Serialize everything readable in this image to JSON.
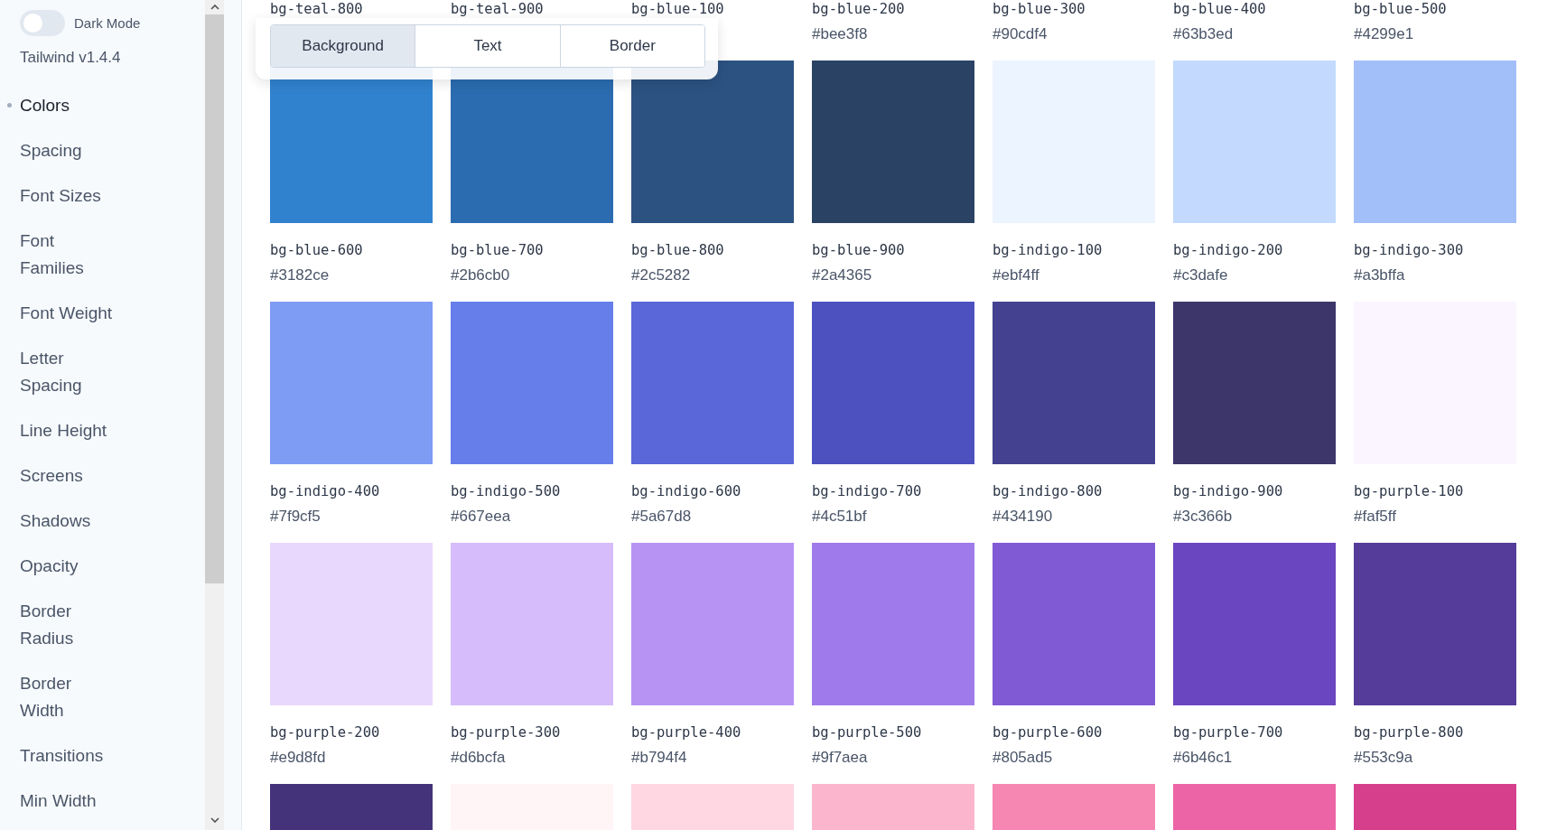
{
  "sidebar": {
    "dark_mode": {
      "label": "Dark Mode",
      "on": false
    },
    "version": "Tailwind v1.4.4",
    "nav": [
      {
        "label": "Colors",
        "selected": true
      },
      {
        "label": "Spacing",
        "selected": false
      },
      {
        "label": "Font Sizes",
        "selected": false
      },
      {
        "label": "Font Families",
        "selected": false
      },
      {
        "label": "Font Weight",
        "selected": false
      },
      {
        "label": "Letter Spacing",
        "selected": false
      },
      {
        "label": "Line Height",
        "selected": false
      },
      {
        "label": "Screens",
        "selected": false
      },
      {
        "label": "Shadows",
        "selected": false
      },
      {
        "label": "Opacity",
        "selected": false
      },
      {
        "label": "Border Radius",
        "selected": false
      },
      {
        "label": "Border Width",
        "selected": false
      },
      {
        "label": "Transitions",
        "selected": false
      },
      {
        "label": "Min Width",
        "selected": false
      }
    ]
  },
  "mode_tabs": [
    {
      "label": "Background",
      "selected": true
    },
    {
      "label": "Text",
      "selected": false
    },
    {
      "label": "Border",
      "selected": false
    }
  ],
  "swatch_rows": [
    [
      {
        "name": "bg-teal-800"
      },
      {
        "name": "bg-teal-900"
      },
      {
        "name": "bg-blue-100"
      },
      {
        "name": "bg-blue-200",
        "hex": "#bee3f8"
      },
      {
        "name": "bg-blue-300",
        "hex": "#90cdf4"
      },
      {
        "name": "bg-blue-400",
        "hex": "#63b3ed"
      },
      {
        "name": "bg-blue-500",
        "hex": "#4299e1"
      }
    ],
    [
      {
        "color": "#3182ce",
        "name": "bg-blue-600",
        "hex": "#3182ce"
      },
      {
        "color": "#2b6cb0",
        "name": "bg-blue-700",
        "hex": "#2b6cb0"
      },
      {
        "color": "#2c5282",
        "name": "bg-blue-800",
        "hex": "#2c5282"
      },
      {
        "color": "#2a4365",
        "name": "bg-blue-900",
        "hex": "#2a4365"
      },
      {
        "color": "#ebf4ff",
        "name": "bg-indigo-100",
        "hex": "#ebf4ff"
      },
      {
        "color": "#c3dafe",
        "name": "bg-indigo-200",
        "hex": "#c3dafe"
      },
      {
        "color": "#a3bffa",
        "name": "bg-indigo-300",
        "hex": "#a3bffa"
      }
    ],
    [
      {
        "color": "#7f9cf5",
        "name": "bg-indigo-400",
        "hex": "#7f9cf5"
      },
      {
        "color": "#667eea",
        "name": "bg-indigo-500",
        "hex": "#667eea"
      },
      {
        "color": "#5a67d8",
        "name": "bg-indigo-600",
        "hex": "#5a67d8"
      },
      {
        "color": "#4c51bf",
        "name": "bg-indigo-700",
        "hex": "#4c51bf"
      },
      {
        "color": "#434190",
        "name": "bg-indigo-800",
        "hex": "#434190"
      },
      {
        "color": "#3c366b",
        "name": "bg-indigo-900",
        "hex": "#3c366b"
      },
      {
        "color": "#faf5ff",
        "name": "bg-purple-100",
        "hex": "#faf5ff"
      }
    ],
    [
      {
        "color": "#e9d8fd",
        "name": "bg-purple-200",
        "hex": "#e9d8fd"
      },
      {
        "color": "#d6bcfa",
        "name": "bg-purple-300",
        "hex": "#d6bcfa"
      },
      {
        "color": "#b794f4",
        "name": "bg-purple-400",
        "hex": "#b794f4"
      },
      {
        "color": "#9f7aea",
        "name": "bg-purple-500",
        "hex": "#9f7aea"
      },
      {
        "color": "#805ad5",
        "name": "bg-purple-600",
        "hex": "#805ad5"
      },
      {
        "color": "#6b46c1",
        "name": "bg-purple-700",
        "hex": "#6b46c1"
      },
      {
        "color": "#553c9a",
        "name": "bg-purple-800",
        "hex": "#553c9a"
      }
    ],
    [
      {
        "color": "#44337a"
      },
      {
        "color": "#fff5f7"
      },
      {
        "color": "#fed7e2"
      },
      {
        "color": "#fbb6ce"
      },
      {
        "color": "#f687b3"
      },
      {
        "color": "#ed64a6"
      },
      {
        "color": "#d53f8c"
      }
    ]
  ]
}
